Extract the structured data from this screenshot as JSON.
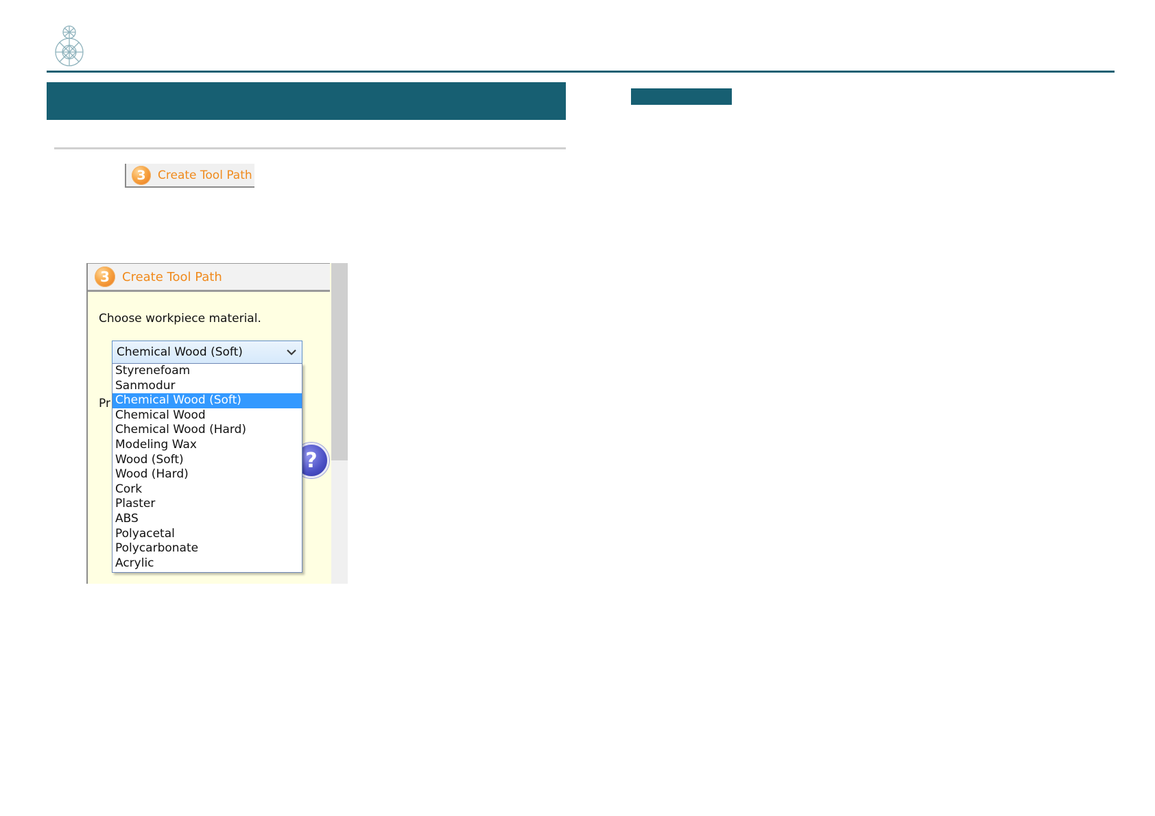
{
  "header": {
    "logo_icon": "gem-figure-icon",
    "accent_color": "#175f72"
  },
  "step_button": {
    "step_number": "3",
    "label": "Create Tool Path"
  },
  "panel": {
    "step_number": "3",
    "title": "Create Tool Path",
    "prompt": "Choose workpiece material.",
    "hidden_label": "Pr",
    "help_icon": "help-icon",
    "help_glyph": "?",
    "material_select": {
      "value": "Chemical Wood (Soft)",
      "options": [
        "Styrenefoam",
        "Sanmodur",
        "Chemical Wood (Soft)",
        "Chemical Wood",
        "Chemical Wood (Hard)",
        "Modeling Wax",
        "Wood (Soft)",
        "Wood (Hard)",
        "Cork",
        "Plaster",
        "ABS",
        "Polyacetal",
        "Polycarbonate",
        "Acrylic"
      ],
      "selected_index": 2,
      "highlight_color": "#3399ff"
    }
  }
}
